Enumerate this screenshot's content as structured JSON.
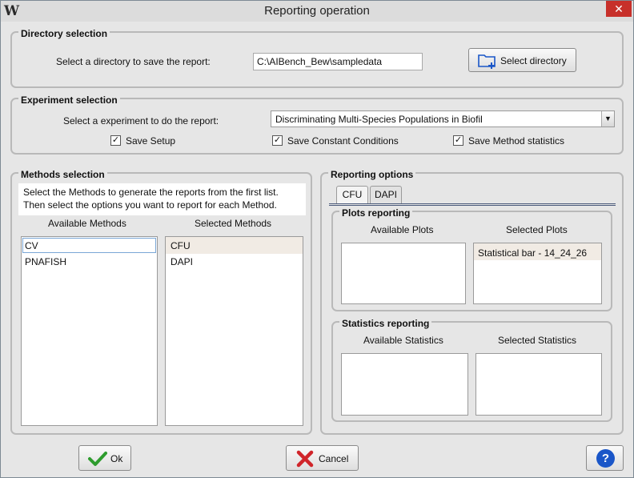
{
  "window": {
    "title": "Reporting operation",
    "icon_glyph": "W",
    "close_glyph": "✕"
  },
  "directory": {
    "title": "Directory selection",
    "prompt": "Select a directory to save the report:",
    "path": "C:\\AIBench_Bew\\sampledata",
    "button_label": "Select directory"
  },
  "experiment": {
    "title": "Experiment selection",
    "prompt": "Select a experiment to do the report:",
    "selected": "Discriminating Multi-Species Populations in Biofil",
    "checkboxes": [
      {
        "label": "Save Setup",
        "checked": true
      },
      {
        "label": "Save Constant Conditions",
        "checked": true
      },
      {
        "label": "Save Method statistics",
        "checked": true
      }
    ]
  },
  "methods": {
    "title": "Methods selection",
    "info_line1": "Select the Methods to generate the reports from the first list.",
    "info_line2": "Then select the options you want to report for each Method.",
    "available_header": "Available Methods",
    "selected_header": "Selected Methods",
    "available": [
      "CV",
      "PNAFISH"
    ],
    "selected": [
      "CFU",
      "DAPI"
    ]
  },
  "reporting": {
    "title": "Reporting options",
    "tabs": [
      "CFU",
      "DAPI"
    ],
    "plots": {
      "title": "Plots reporting",
      "available_header": "Available Plots",
      "selected_header": "Selected Plots",
      "selected": [
        "Statistical bar - 14_24_26"
      ]
    },
    "statistics": {
      "title": "Statistics reporting",
      "available_header": "Available Statistics",
      "selected_header": "Selected Statistics"
    }
  },
  "footer": {
    "ok_label": "Ok",
    "cancel_label": "Cancel",
    "help_glyph": "?"
  },
  "colors": {
    "accent_blue": "#1a56c8",
    "ok_green": "#2e9c2e",
    "cancel_red": "#d0252a"
  }
}
